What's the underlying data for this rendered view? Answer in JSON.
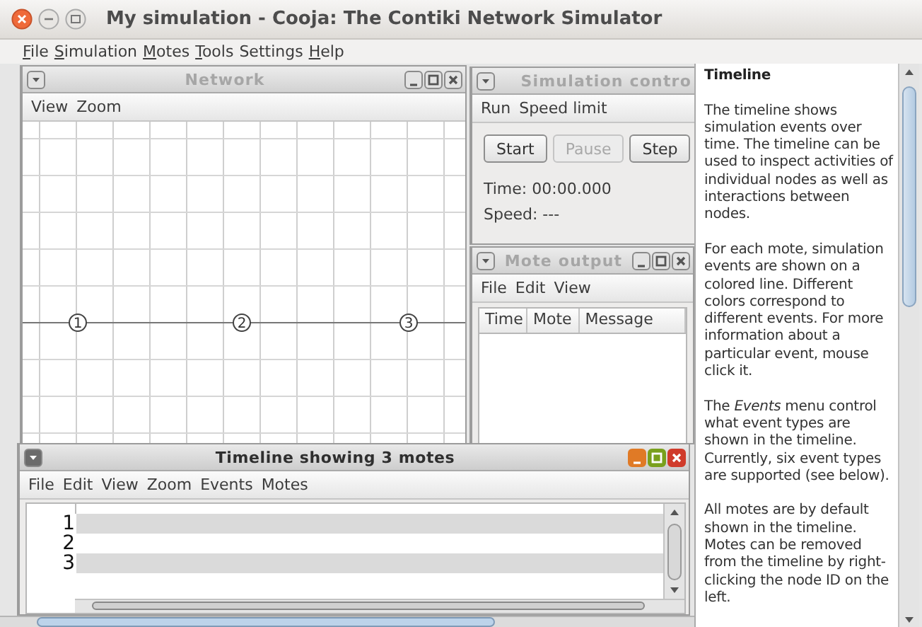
{
  "window": {
    "title": "My simulation - Cooja: The Contiki Network Simulator"
  },
  "menu": [
    {
      "label": "File",
      "mnemonic": true
    },
    {
      "label": "Simulation",
      "mnemonic": true
    },
    {
      "label": "Motes",
      "mnemonic": true
    },
    {
      "label": "Tools",
      "mnemonic": true
    },
    {
      "label": "Settings",
      "mnemonic": false
    },
    {
      "label": "Help",
      "mnemonic": true
    }
  ],
  "network": {
    "title": "Network",
    "active": false,
    "menu": [
      "View",
      "Zoom"
    ],
    "motes": [
      {
        "label": "1"
      },
      {
        "label": "2"
      },
      {
        "label": "3"
      }
    ]
  },
  "simulation_control": {
    "title": "Simulation contro",
    "active": false,
    "menu": [
      "Run",
      "Speed limit"
    ],
    "buttons": [
      {
        "label": "Start",
        "disabled": false
      },
      {
        "label": "Pause",
        "disabled": true
      },
      {
        "label": "Step",
        "disabled": false
      }
    ],
    "time": "Time: 00:00.000",
    "speed": "Speed: ---"
  },
  "mote_output": {
    "title": "Mote output",
    "active": false,
    "menu": [
      "File",
      "Edit",
      "View"
    ],
    "columns": [
      "Time",
      "Mote",
      "Message"
    ]
  },
  "help": {
    "title": "Timeline",
    "paragraphs": [
      "The timeline shows simulation events over time. The timeline can be used to inspect activities of individual nodes as well as interactions between nodes.",
      "For each mote, simulation events are shown on a colored line. Different colors correspond to different events. For more information about a particular event, mouse click it.",
      "The *Events* menu control what event types are shown in the timeline. Currently, six event types are supported (see below).",
      "All motes are by default shown in the timeline. Motes can be removed from the timeline by right-clicking the node ID on the left."
    ]
  },
  "timeline": {
    "title": "Timeline showing 3 motes",
    "active": true,
    "menu": [
      "File",
      "Edit",
      "View",
      "Zoom",
      "Events",
      "Motes"
    ],
    "motes": [
      {
        "label": "1"
      },
      {
        "label": "2"
      },
      {
        "label": "3"
      }
    ]
  }
}
